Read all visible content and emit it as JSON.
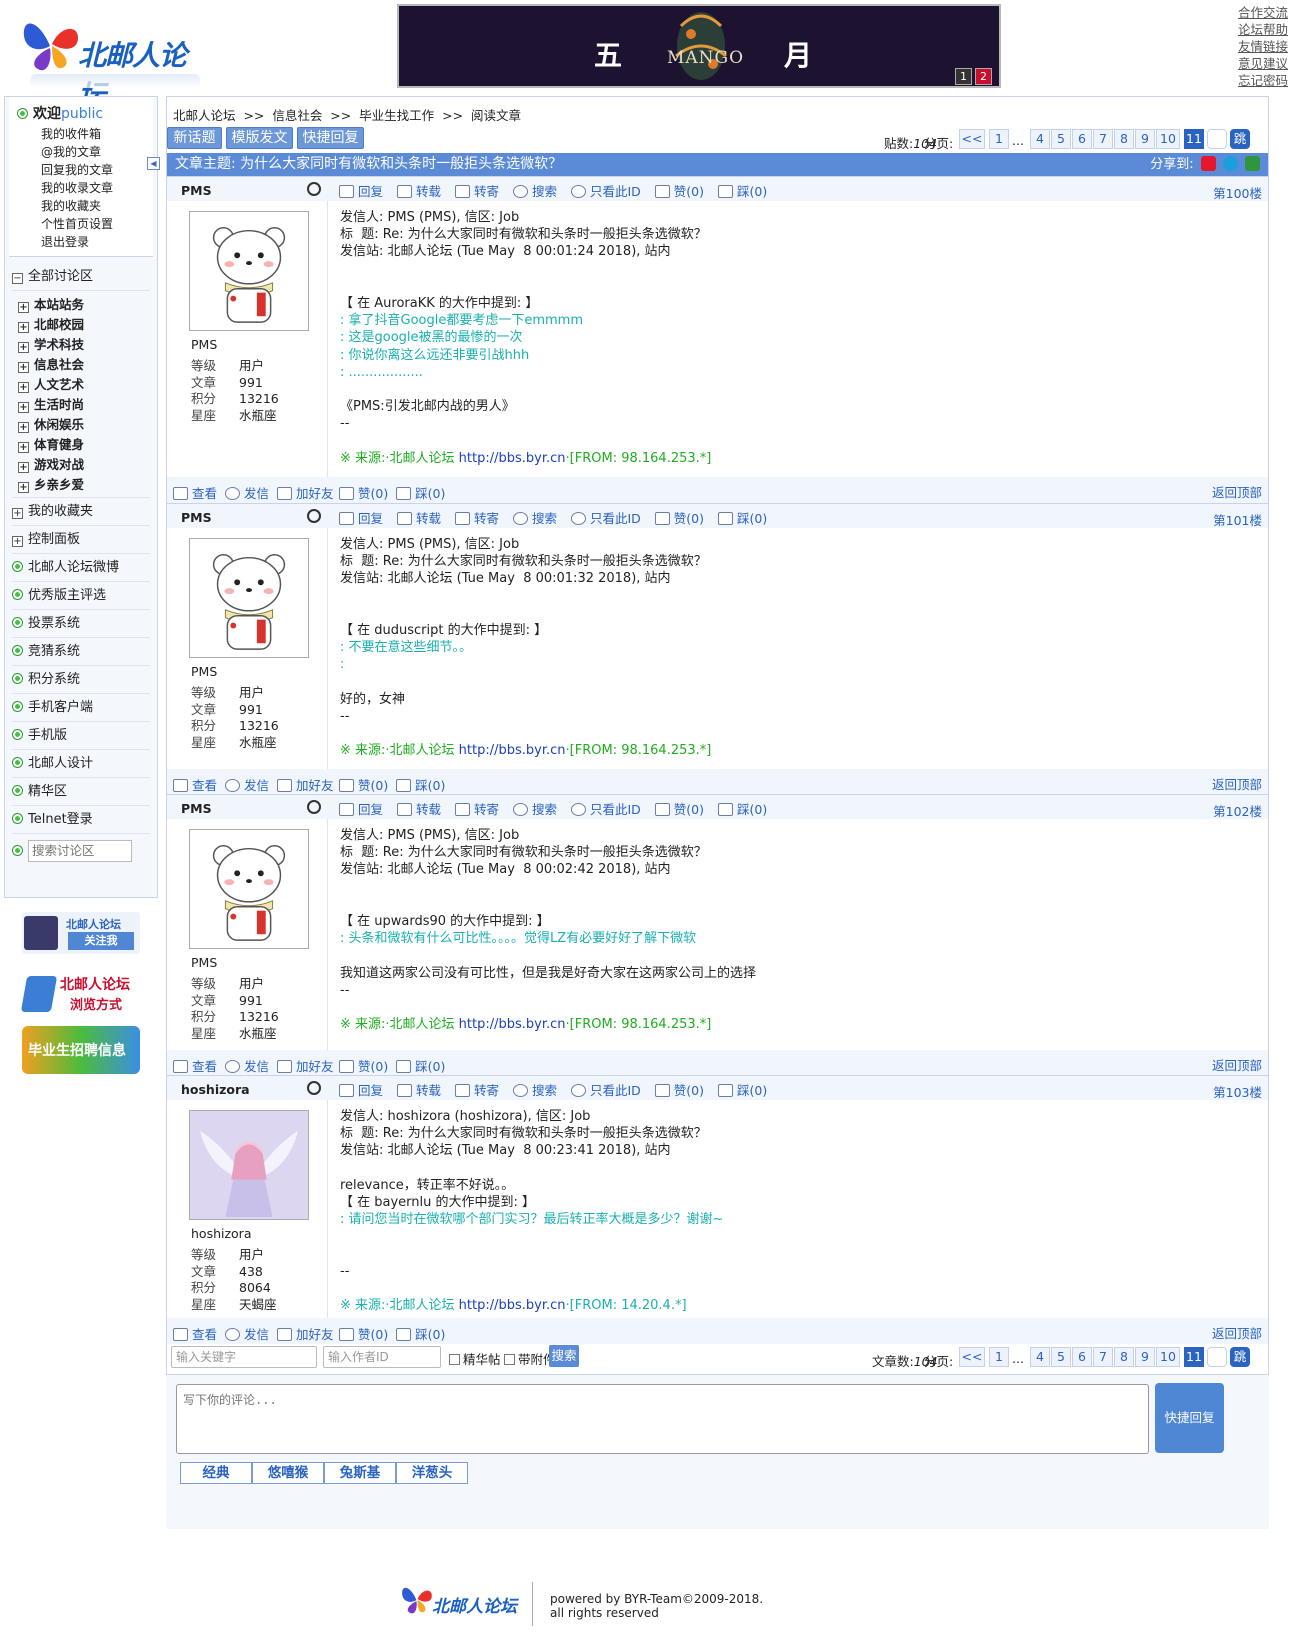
{
  "site": {
    "logo_text": "北邮人论坛",
    "banner": {
      "char1": "五",
      "char2": "月",
      "brand": "MANGO",
      "pages": [
        "1",
        "2"
      ]
    },
    "top_links": [
      "合作交流",
      "论坛帮助",
      "友情链接",
      "意见建议",
      "忘记密码"
    ]
  },
  "sidebar": {
    "welcome": "欢迎",
    "user": "public",
    "links": [
      "我的收件箱",
      "@我的文章",
      "回复我的文章",
      "我的收录文章",
      "我的收藏夹",
      "个性首页设置",
      "退出登录"
    ],
    "collapse_glyph": "◀",
    "all_boards": "全部讨论区",
    "categories": [
      "本站站务",
      "北邮校园",
      "学术科技",
      "信息社会",
      "人文艺术",
      "生活时尚",
      "休闲娱乐",
      "体育健身",
      "游戏对战",
      "乡亲乡爱"
    ],
    "plus_items": [
      "我的收藏夹",
      "控制面板"
    ],
    "items": [
      "北邮人论坛微博",
      "优秀版主评选",
      "投票系统",
      "竞猜系统",
      "积分系统",
      "手机客户端",
      "手机版",
      "北邮人设计",
      "精华区",
      "Telnet登录"
    ],
    "search_placeholder": "搜索讨论区",
    "promo": [
      {
        "title": "北邮人论坛",
        "sub": "关注我"
      },
      {
        "title": "北邮人论坛",
        "sub": "浏览方式"
      },
      {
        "title": "毕业生招聘信息"
      }
    ]
  },
  "breadcrumb": "北邮人论坛  >>  信息社会  >>  毕业生找工作  >>  阅读文章",
  "toolbar": {
    "new_topic": "新话题",
    "template_post": "模版发文",
    "quick_reply": "快捷回复"
  },
  "pager_top": {
    "count_label": "贴数:",
    "count": "104",
    "page_label": "分页:"
  },
  "pager_bottom": {
    "count_label": "文章数:",
    "count": "104",
    "page_label": "分页:"
  },
  "pages": [
    "<<",
    "1",
    "...",
    "4",
    "5",
    "6",
    "7",
    "8",
    "9",
    "10",
    "11"
  ],
  "jump": "跳",
  "subject": {
    "label": "文章主题: 为什么大家同时有微软和头条时一般拒头条选微软？",
    "share": "分享到:"
  },
  "post_actions": [
    "回复",
    "转载",
    "转寄",
    "搜索",
    "只看此ID",
    "赞(0)",
    "踩(0)"
  ],
  "user_actions": [
    "查看",
    "发信",
    "加好友"
  ],
  "back_to_top": "返回顶部",
  "stat_keys": [
    "等级",
    "文章",
    "积分",
    "星座"
  ],
  "posts": [
    {
      "user": "PMS",
      "floor": "第100楼",
      "stats": [
        "用户",
        "991",
        "13216",
        "水瓶座"
      ],
      "lines": [
        {
          "t": "发信人: PMS (PMS), 信区: Job",
          "c": ""
        },
        {
          "t": "标  题: Re: 为什么大家同时有微软和头条时一般拒头条选微软？",
          "c": ""
        },
        {
          "t": "发信站: 北邮人论坛 (Tue May  8 00:01:24 2018), 站内",
          "c": ""
        },
        {
          "t": " ",
          "c": ""
        },
        {
          "t": " ",
          "c": ""
        },
        {
          "t": "【 在 AuroraKK 的大作中提到: 】",
          "c": ""
        },
        {
          "t": ": 拿了抖音Google都要考虑一下emmmm",
          "c": "q"
        },
        {
          "t": ": 这是google被黑的最惨的一次",
          "c": "q"
        },
        {
          "t": ": 你说你离这么远还非要引战hhh",
          "c": "q"
        },
        {
          "t": ": ..................",
          "c": "q"
        },
        {
          "t": " ",
          "c": ""
        },
        {
          "t": "《PMS:引发北邮内战的男人》",
          "c": ""
        },
        {
          "t": "--",
          "c": ""
        },
        {
          "t": " ",
          "c": ""
        },
        {
          "t": "※ 来源:·北邮人论坛 ",
          "c": "src",
          "link": "http://bbs.byr.cn",
          "after": "·[FROM: 98.164.253.*]"
        }
      ]
    },
    {
      "user": "PMS",
      "floor": "第101楼",
      "stats": [
        "用户",
        "991",
        "13216",
        "水瓶座"
      ],
      "lines": [
        {
          "t": "发信人: PMS (PMS), 信区: Job",
          "c": ""
        },
        {
          "t": "标  题: Re: 为什么大家同时有微软和头条时一般拒头条选微软？",
          "c": ""
        },
        {
          "t": "发信站: 北邮人论坛 (Tue May  8 00:01:32 2018), 站内",
          "c": ""
        },
        {
          "t": " ",
          "c": ""
        },
        {
          "t": " ",
          "c": ""
        },
        {
          "t": "【 在 duduscript 的大作中提到: 】",
          "c": ""
        },
        {
          "t": ": 不要在意这些细节。。",
          "c": "q"
        },
        {
          "t": ":",
          "c": "q"
        },
        {
          "t": " ",
          "c": ""
        },
        {
          "t": "好的，女神",
          "c": ""
        },
        {
          "t": "--",
          "c": ""
        },
        {
          "t": " ",
          "c": ""
        },
        {
          "t": "※ 来源:·北邮人论坛 ",
          "c": "src",
          "link": "http://bbs.byr.cn",
          "after": "·[FROM: 98.164.253.*]"
        }
      ]
    },
    {
      "user": "PMS",
      "floor": "第102楼",
      "stats": [
        "用户",
        "991",
        "13216",
        "水瓶座"
      ],
      "lines": [
        {
          "t": "发信人: PMS (PMS), 信区: Job",
          "c": ""
        },
        {
          "t": "标  题: Re: 为什么大家同时有微软和头条时一般拒头条选微软？",
          "c": ""
        },
        {
          "t": "发信站: 北邮人论坛 (Tue May  8 00:02:42 2018), 站内",
          "c": ""
        },
        {
          "t": " ",
          "c": ""
        },
        {
          "t": " ",
          "c": ""
        },
        {
          "t": "【 在 upwards90 的大作中提到: 】",
          "c": ""
        },
        {
          "t": ": 头条和微软有什么可比性。。。。觉得LZ有必要好好了解下微软",
          "c": "q"
        },
        {
          "t": " ",
          "c": ""
        },
        {
          "t": "我知道这两家公司没有可比性，但是我是好奇大家在这两家公司上的选择",
          "c": ""
        },
        {
          "t": "--",
          "c": ""
        },
        {
          "t": " ",
          "c": ""
        },
        {
          "t": "※ 来源:·北邮人论坛 ",
          "c": "src",
          "link": "http://bbs.byr.cn",
          "after": "·[FROM: 98.164.253.*]"
        }
      ]
    },
    {
      "user": "hoshizora",
      "floor": "第103楼",
      "stats": [
        "用户",
        "438",
        "8064",
        "天蝎座"
      ],
      "lines": [
        {
          "t": "发信人: hoshizora (hoshizora), 信区: Job",
          "c": ""
        },
        {
          "t": "标  题: Re: 为什么大家同时有微软和头条时一般拒头条选微软？",
          "c": ""
        },
        {
          "t": "发信站: 北邮人论坛 (Tue May  8 00:23:41 2018), 站内",
          "c": ""
        },
        {
          "t": " ",
          "c": ""
        },
        {
          "t": "relevance，转正率不好说。。",
          "c": ""
        },
        {
          "t": "【 在 bayernlu 的大作中提到: 】",
          "c": ""
        },
        {
          "t": ": 请问您当时在微软哪个部门实习？最后转正率大概是多少？谢谢~",
          "c": "q"
        },
        {
          "t": " ",
          "c": ""
        },
        {
          "t": " ",
          "c": ""
        },
        {
          "t": "--",
          "c": ""
        },
        {
          "t": " ",
          "c": ""
        },
        {
          "t": "※ 来源:·北邮人论坛 ",
          "c": "q",
          "link": "http://bbs.byr.cn",
          "after": "·[FROM: 14.20.4.*]"
        }
      ]
    }
  ],
  "search": {
    "keyword_placeholder": "输入关键字",
    "author_placeholder": "输入作者ID",
    "digest": "精华帖",
    "attachment": "带附件",
    "button": "搜索"
  },
  "reply": {
    "placeholder": "写下你的评论...",
    "button": "快捷回复",
    "emoticons": [
      "经典",
      "悠嘻猴",
      "兔斯基",
      "洋葱头"
    ]
  },
  "footer": {
    "logo_text": "北邮人论坛",
    "line1": "powered by BYR-Team©2009-2018.",
    "line2": "all rights reserved"
  }
}
